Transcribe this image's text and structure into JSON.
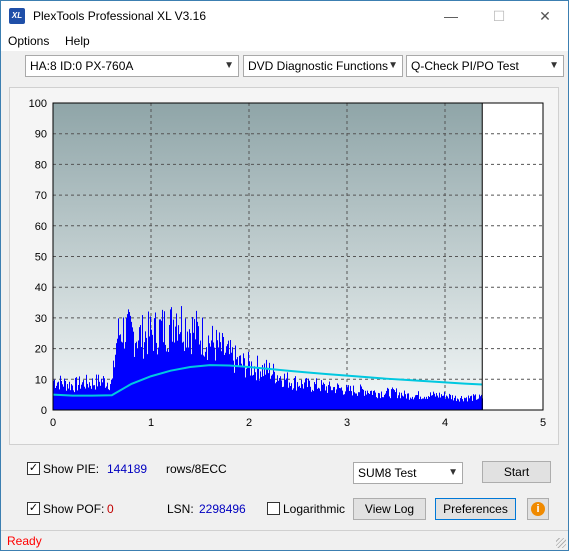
{
  "window": {
    "title": "PlexTools Professional XL V3.16",
    "icon_label": "XL",
    "minimize_glyph": "—",
    "maximize_glyph": "☐",
    "close_glyph": "✕"
  },
  "menu": {
    "items": [
      {
        "label": "Options",
        "accel": "O"
      },
      {
        "label": "Help",
        "accel": "H"
      }
    ]
  },
  "toolbar": {
    "drive_select": "HA:8 ID:0  PX-760A",
    "function_select": "DVD Diagnostic Functions",
    "test_select": "Q-Check PI/PO Test"
  },
  "chart_data": {
    "type": "bar",
    "title": "",
    "xlabel": "",
    "ylabel": "",
    "xlim": [
      0,
      5
    ],
    "ylim": [
      0,
      100
    ],
    "x_ticks": [
      "0",
      "1",
      "2",
      "3",
      "4",
      "5"
    ],
    "y_ticks": [
      "0",
      "10",
      "20",
      "30",
      "40",
      "50",
      "60",
      "70",
      "80",
      "90",
      "100"
    ],
    "grid": true,
    "end_marker_x": 4.38,
    "colors": {
      "bars": "#0000ff",
      "curve": "#00c8e0",
      "background_top": "#8fa5a8",
      "background_bottom": "#f4f8f8",
      "grid": "#555555"
    },
    "series": [
      {
        "type": "bar",
        "x": [
          0.0,
          0.1,
          0.2,
          0.3,
          0.4,
          0.5,
          0.6,
          0.65,
          0.7,
          0.8,
          0.9,
          1.0,
          1.1,
          1.2,
          1.25,
          1.3,
          1.4,
          1.5,
          1.6,
          1.7,
          1.8,
          1.9,
          2.0,
          2.1,
          2.2,
          2.3,
          2.4,
          2.5,
          2.6,
          2.7,
          2.8,
          2.9,
          3.0,
          3.1,
          3.2,
          3.3,
          3.4,
          3.5,
          3.6,
          3.7,
          3.8,
          3.9,
          4.0,
          4.1,
          4.2,
          4.3,
          4.38
        ],
        "values": [
          12,
          11,
          10,
          11,
          11,
          12,
          11,
          30,
          33,
          31,
          30,
          31,
          33,
          34,
          40,
          36,
          33,
          31,
          28,
          25,
          22,
          19,
          18,
          17,
          16,
          14,
          12,
          11,
          10,
          10,
          9,
          9,
          8,
          8,
          8,
          7,
          7,
          7,
          6,
          6,
          6,
          6,
          6,
          5,
          5,
          5,
          5
        ]
      },
      {
        "type": "line",
        "x": [
          0.0,
          0.2,
          0.4,
          0.6,
          0.8,
          1.0,
          1.2,
          1.4,
          1.6,
          1.8,
          2.0,
          2.2,
          2.4,
          2.6,
          2.8,
          3.0,
          3.2,
          3.4,
          3.6,
          3.8,
          4.0,
          4.2,
          4.38
        ],
        "values": [
          5,
          4.7,
          4.7,
          4.8,
          8.5,
          11,
          12.8,
          14,
          14.6,
          14.5,
          14,
          13.4,
          12.8,
          12.2,
          11.7,
          11.2,
          10.7,
          10.2,
          9.8,
          9.4,
          9.0,
          8.6,
          8.3
        ]
      }
    ]
  },
  "controls": {
    "show_pie_label": "Show PIE:",
    "show_pie_checked": "✓",
    "pie_value": "144189",
    "rows_label": "rows/8ECC",
    "show_pof_label": "Show POF:",
    "show_pof_checked": "✓",
    "pof_value": "0",
    "lsn_label": "LSN:",
    "lsn_value": "2298496",
    "logarithmic_label": "Logarithmic",
    "logarithmic_checked": "",
    "sum_select": "SUM8 Test",
    "start_button": "Start",
    "view_log_button": "View Log",
    "preferences_button": "Preferences",
    "info_icon_glyph": "i"
  },
  "status": {
    "text": "Ready"
  }
}
